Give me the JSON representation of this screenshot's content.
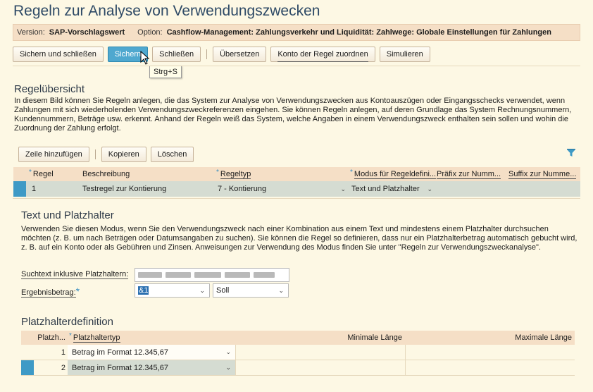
{
  "page_title": "Regeln zur Analyse von Verwendungszwecken",
  "infobar": {
    "version_label": "Version:",
    "version_value": "SAP-Vorschlagswert",
    "option_label": "Option:",
    "option_value": "Cashflow-Management: Zahlungsverkehr und Liquidität: Zahlwege: Globale Einstellungen für Zahlungen"
  },
  "toolbar": {
    "save_close": "Sichern und schließen",
    "save": "Sichern",
    "close": "Schließen",
    "translate": "Übersetzen",
    "assign_account": "Konto der Regel zuordnen",
    "simulate": "Simulieren"
  },
  "tooltip": "Strg+S",
  "overview": {
    "title": "Regelübersicht",
    "text": "In diesem Bild können Sie Regeln anlegen, die das System zur Analyse von Verwendungszwecken aus Kontoauszügen oder Eingangsschecks verwendet, wenn Zahlungen mit sich wiederholenden Verwendungszweckreferenzen eingehen. Sie können Regeln anlegen, auf deren Grundlage das System Rechnungsnummern, Kundennummern, Beträge usw. erkennt. Anhand der Regeln weiß das System, welche Angaben in einem Verwendungszweck enthalten sein sollen und wohin die Zuordnung der Zahlung erfolgt.",
    "btn_add": "Zeile hinzufügen",
    "btn_copy": "Kopieren",
    "btn_delete": "Löschen",
    "columns": {
      "rule": "Regel",
      "desc": "Beschreibung",
      "type": "Regeltyp",
      "mode": "Modus für Regeldefini...",
      "prefix": "Präfix zur Numm...",
      "suffix": "Suffix zur Numme..."
    },
    "rows": [
      {
        "rule": "1",
        "desc": "Testregel zur Kontierung",
        "type": "7 - Kontierung",
        "mode": "Text und Platzhalter",
        "prefix": "",
        "suffix": ""
      }
    ]
  },
  "text_section": {
    "title": "Text und Platzhalter",
    "text": "Verwenden Sie diesen Modus, wenn Sie den Verwendungszweck nach einer Kombination aus einem Text und mindestens einem Platzhalter durchsuchen möchten (z. B. um nach Beträgen oder Datumsangaben zu suchen). Sie können die Regel so definieren, dass nur ein Platzhalterbetrag automatisch gebucht wird, z. B. auf ein Konto oder als Gebühren und Zinsen. Anweisungen zur Verwendung des Modus finden Sie unter \"Regeln zur Verwendungszweckanalyse\".",
    "search_label": "Suchtext inklusive Platzhaltern:",
    "result_label": "Ergebnisbetrag:",
    "result_value": "&1",
    "result_side": "Soll"
  },
  "placeholder_section": {
    "title": "Platzhalterdefinition",
    "columns": {
      "pos": "Platzh...",
      "type": "Platzhaltertyp",
      "min": "Minimale Länge",
      "max": "Maximale Länge"
    },
    "rows": [
      {
        "pos": "1",
        "type": "Betrag im Format 12.345,67",
        "min": "",
        "max": ""
      },
      {
        "pos": "2",
        "type": "Betrag im Format 12.345,67",
        "min": "",
        "max": ""
      }
    ]
  },
  "colors": {
    "accent": "#4fa8cf",
    "header_bg": "#f5dfc6",
    "page_bg": "#fdf8e4",
    "row_selected": "#d5dcd2"
  }
}
